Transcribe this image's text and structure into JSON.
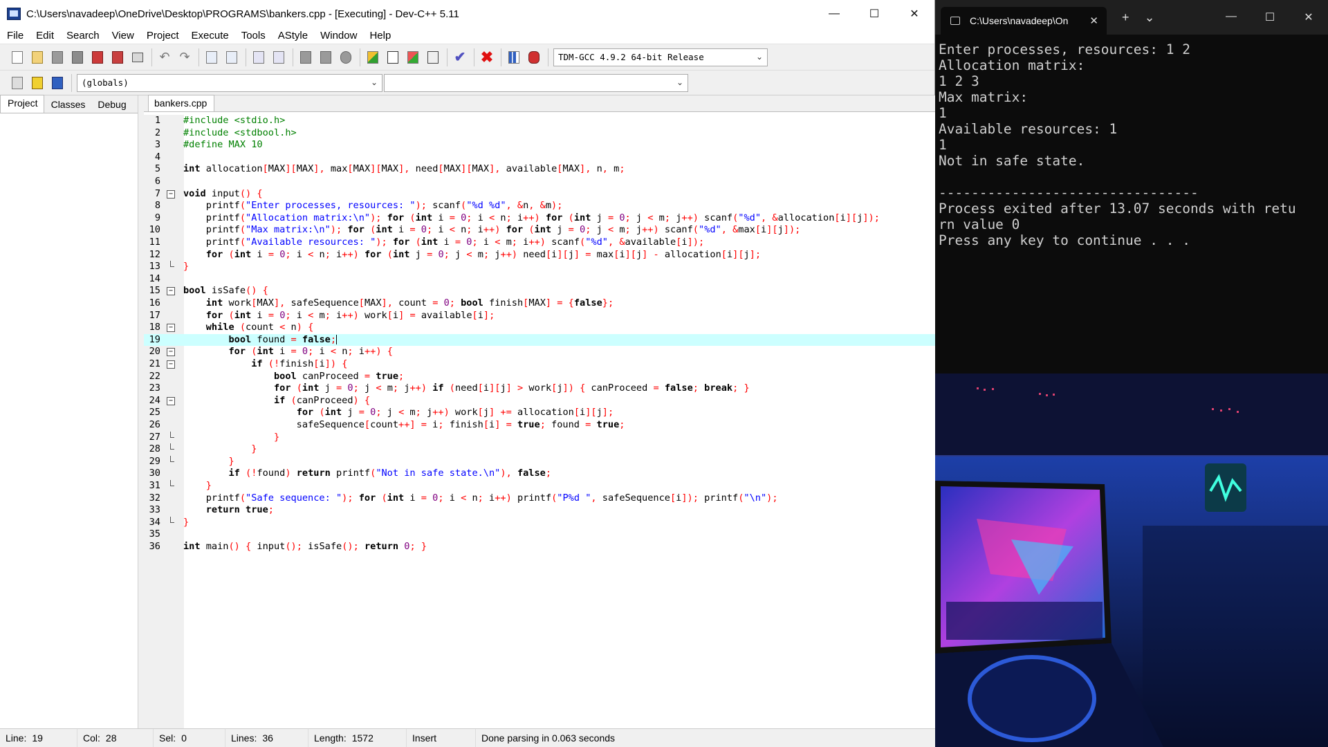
{
  "ide": {
    "title": "C:\\Users\\navadeep\\OneDrive\\Desktop\\PROGRAMS\\bankers.cpp - [Executing] - Dev-C++ 5.11",
    "window_buttons": {
      "minimize": "—",
      "maximize": "☐",
      "close": "✕"
    },
    "menu": [
      "File",
      "Edit",
      "Search",
      "View",
      "Project",
      "Execute",
      "Tools",
      "AStyle",
      "Window",
      "Help"
    ],
    "compiler_select": "TDM-GCC 4.9.2 64-bit Release",
    "scope_select": "(globals)",
    "function_select": "",
    "left_tabs": [
      "Project",
      "Classes",
      "Debug"
    ],
    "file_tab": "bankers.cpp",
    "current_line": 19,
    "status": {
      "line_label": "Line:",
      "line": "19",
      "col_label": "Col:",
      "col": "28",
      "sel_label": "Sel:",
      "sel": "0",
      "lines_label": "Lines:",
      "lines": "36",
      "length_label": "Length:",
      "length": "1572",
      "mode": "Insert",
      "message": "Done parsing in 0.063 seconds"
    }
  },
  "code_lines": [
    "#include <stdio.h>",
    "#include <stdbool.h>",
    "#define MAX 10",
    "",
    "int allocation[MAX][MAX], max[MAX][MAX], need[MAX][MAX], available[MAX], n, m;",
    "",
    "void input() {",
    "    printf(\"Enter processes, resources: \"); scanf(\"%d %d\", &n, &m);",
    "    printf(\"Allocation matrix:\\n\"); for (int i = 0; i < n; i++) for (int j = 0; j < m; j++) scanf(\"%d\", &allocation[i][j]);",
    "    printf(\"Max matrix:\\n\"); for (int i = 0; i < n; i++) for (int j = 0; j < m; j++) scanf(\"%d\", &max[i][j]);",
    "    printf(\"Available resources: \"); for (int i = 0; i < m; i++) scanf(\"%d\", &available[i]);",
    "    for (int i = 0; i < n; i++) for (int j = 0; j < m; j++) need[i][j] = max[i][j] - allocation[i][j];",
    "}",
    "",
    "bool isSafe() {",
    "    int work[MAX], safeSequence[MAX], count = 0; bool finish[MAX] = {false};",
    "    for (int i = 0; i < m; i++) work[i] = available[i];",
    "    while (count < n) {",
    "        bool found = false;",
    "        for (int i = 0; i < n; i++) {",
    "            if (!finish[i]) {",
    "                bool canProceed = true;",
    "                for (int j = 0; j < m; j++) if (need[i][j] > work[j]) { canProceed = false; break; }",
    "                if (canProceed) {",
    "                    for (int j = 0; j < m; j++) work[j] += allocation[i][j];",
    "                    safeSequence[count++] = i; finish[i] = true; found = true;",
    "                }",
    "            }",
    "        }",
    "        if (!found) return printf(\"Not in safe state.\\n\"), false;",
    "    }",
    "    printf(\"Safe sequence: \"); for (int i = 0; i < n; i++) printf(\"P%d \", safeSequence[i]); printf(\"\\n\");",
    "    return true;",
    "}",
    "",
    "int main() { input(); isSafe(); return 0; }"
  ],
  "fold_lines": [
    7,
    15,
    18,
    20,
    21,
    24
  ],
  "fold_end_lines": [
    13,
    27,
    28,
    29,
    31,
    34
  ],
  "terminal": {
    "tab_title": "C:\\Users\\navadeep\\On",
    "new_tab": "+",
    "dropdown": "⌄",
    "output": "Enter processes, resources: 1 2\nAllocation matrix:\n1 2 3\nMax matrix:\n1\nAvailable resources: 1\n1\nNot in safe state.\n\n--------------------------------\nProcess exited after 13.07 seconds with retu\nrn value 0\nPress any key to continue . . ."
  }
}
